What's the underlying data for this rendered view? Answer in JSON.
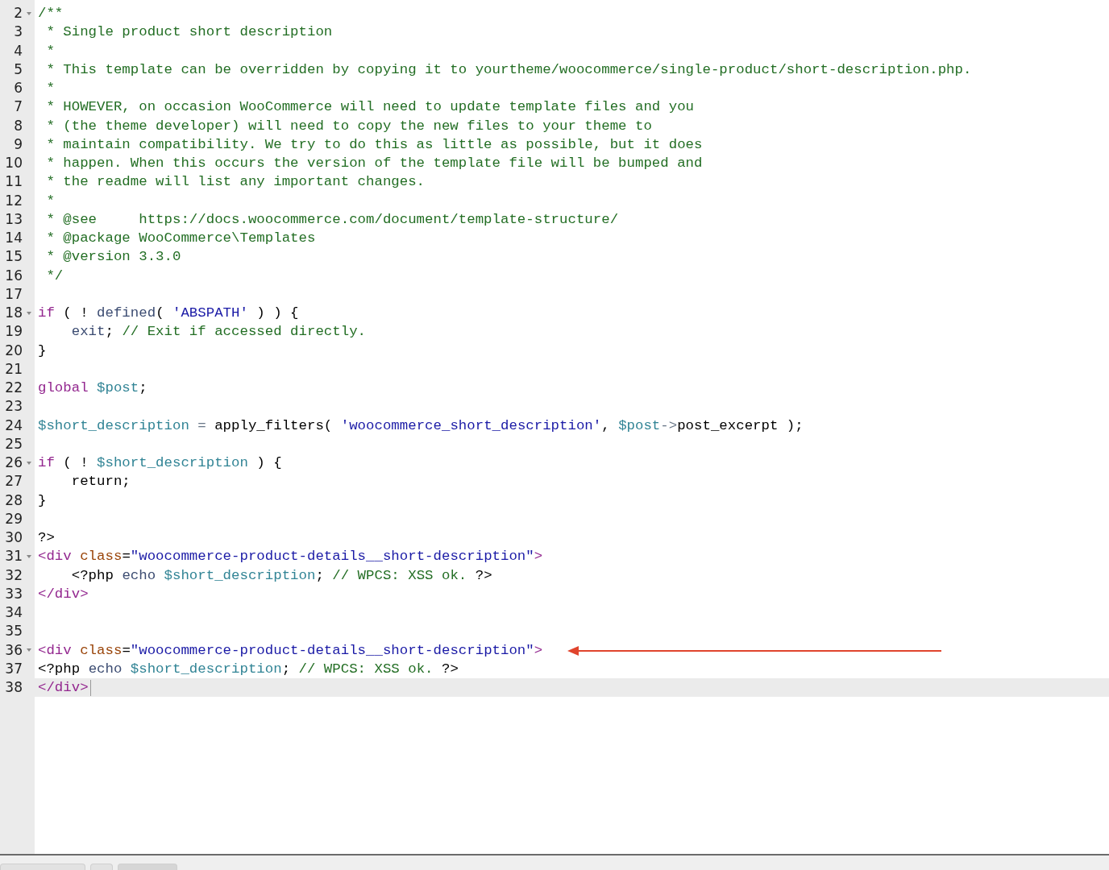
{
  "editor": {
    "lines": [
      {
        "number": "2",
        "fold": true,
        "active": false,
        "cursor": false,
        "marked": false,
        "tokens": [
          {
            "kind": "comment",
            "text": "/**"
          }
        ]
      },
      {
        "number": "3",
        "fold": false,
        "active": false,
        "cursor": false,
        "marked": false,
        "tokens": [
          {
            "kind": "comment",
            "text": " * Single product short description"
          }
        ]
      },
      {
        "number": "4",
        "fold": false,
        "active": false,
        "cursor": false,
        "marked": false,
        "tokens": [
          {
            "kind": "comment",
            "text": " *"
          }
        ]
      },
      {
        "number": "5",
        "fold": false,
        "active": false,
        "cursor": false,
        "marked": false,
        "tokens": [
          {
            "kind": "comment",
            "text": " * This template can be overridden by copying it to yourtheme/woocommerce/single-product/short-description.php."
          }
        ]
      },
      {
        "number": "6",
        "fold": false,
        "active": false,
        "cursor": false,
        "marked": false,
        "tokens": [
          {
            "kind": "comment",
            "text": " *"
          }
        ]
      },
      {
        "number": "7",
        "fold": false,
        "active": false,
        "cursor": false,
        "marked": false,
        "tokens": [
          {
            "kind": "comment",
            "text": " * HOWEVER, on occasion WooCommerce will need to update template files and you"
          }
        ]
      },
      {
        "number": "8",
        "fold": false,
        "active": false,
        "cursor": false,
        "marked": false,
        "tokens": [
          {
            "kind": "comment",
            "text": " * (the theme developer) will need to copy the new files to your theme to"
          }
        ]
      },
      {
        "number": "9",
        "fold": false,
        "active": false,
        "cursor": false,
        "marked": false,
        "tokens": [
          {
            "kind": "comment",
            "text": " * maintain compatibility. We try to do this as little as possible, but it does"
          }
        ]
      },
      {
        "number": "10",
        "fold": false,
        "active": false,
        "cursor": false,
        "marked": false,
        "tokens": [
          {
            "kind": "comment",
            "text": " * happen. When this occurs the version of the template file will be bumped and"
          }
        ]
      },
      {
        "number": "11",
        "fold": false,
        "active": false,
        "cursor": false,
        "marked": false,
        "tokens": [
          {
            "kind": "comment",
            "text": " * the readme will list any important changes."
          }
        ]
      },
      {
        "number": "12",
        "fold": false,
        "active": false,
        "cursor": false,
        "marked": false,
        "tokens": [
          {
            "kind": "comment",
            "text": " *"
          }
        ]
      },
      {
        "number": "13",
        "fold": false,
        "active": false,
        "cursor": false,
        "marked": false,
        "tokens": [
          {
            "kind": "comment",
            "text": " * @see     https://docs.woocommerce.com/document/template-structure/"
          }
        ]
      },
      {
        "number": "14",
        "fold": false,
        "active": false,
        "cursor": false,
        "marked": false,
        "tokens": [
          {
            "kind": "comment",
            "text": " * @package WooCommerce\\Templates"
          }
        ]
      },
      {
        "number": "15",
        "fold": false,
        "active": false,
        "cursor": false,
        "marked": false,
        "tokens": [
          {
            "kind": "comment",
            "text": " * @version 3.3.0"
          }
        ]
      },
      {
        "number": "16",
        "fold": false,
        "active": false,
        "cursor": false,
        "marked": false,
        "tokens": [
          {
            "kind": "comment",
            "text": " */"
          }
        ]
      },
      {
        "number": "17",
        "fold": false,
        "active": false,
        "cursor": false,
        "marked": false
      },
      {
        "number": "18",
        "fold": true,
        "active": false,
        "cursor": false,
        "marked": false,
        "tokens": [
          {
            "kind": "keyword",
            "text": "if"
          },
          {
            "kind": "plain",
            "text": " ( ! "
          },
          {
            "kind": "function",
            "text": "defined"
          },
          {
            "kind": "plain",
            "text": "( "
          },
          {
            "kind": "string",
            "text": "'ABSPATH'"
          },
          {
            "kind": "plain",
            "text": " ) ) {"
          }
        ]
      },
      {
        "number": "19",
        "fold": false,
        "active": false,
        "cursor": false,
        "marked": false,
        "tokens": [
          {
            "kind": "function",
            "text": "    exit"
          },
          {
            "kind": "plain",
            "text": "; "
          },
          {
            "kind": "comment",
            "text": "// Exit if accessed directly."
          }
        ]
      },
      {
        "number": "20",
        "fold": false,
        "active": false,
        "cursor": false,
        "marked": false,
        "tokens": [
          {
            "kind": "plain",
            "text": "}"
          }
        ]
      },
      {
        "number": "21",
        "fold": false,
        "active": false,
        "cursor": false,
        "marked": false
      },
      {
        "number": "22",
        "fold": false,
        "active": false,
        "cursor": false,
        "marked": false,
        "tokens": [
          {
            "kind": "keyword",
            "text": "global"
          },
          {
            "kind": "variable",
            "text": " $post"
          },
          {
            "kind": "plain",
            "text": ";"
          }
        ]
      },
      {
        "number": "23",
        "fold": false,
        "active": false,
        "cursor": false,
        "marked": false
      },
      {
        "number": "24",
        "fold": false,
        "active": false,
        "cursor": false,
        "marked": false,
        "tokens": [
          {
            "kind": "variable",
            "text": "$short_description"
          },
          {
            "kind": "operator",
            "text": " = "
          },
          {
            "kind": "plain",
            "text": "apply_filters( "
          },
          {
            "kind": "string",
            "text": "'woocommerce_short_description'"
          },
          {
            "kind": "plain",
            "text": ", "
          },
          {
            "kind": "variable",
            "text": "$post"
          },
          {
            "kind": "operator",
            "text": "->"
          },
          {
            "kind": "plain",
            "text": "post_excerpt );"
          }
        ]
      },
      {
        "number": "25",
        "fold": false,
        "active": false,
        "cursor": false,
        "marked": false
      },
      {
        "number": "26",
        "fold": true,
        "active": false,
        "cursor": false,
        "marked": false,
        "tokens": [
          {
            "kind": "keyword",
            "text": "if"
          },
          {
            "kind": "plain",
            "text": " ( ! "
          },
          {
            "kind": "variable",
            "text": "$short_description"
          },
          {
            "kind": "plain",
            "text": " ) {"
          }
        ]
      },
      {
        "number": "27",
        "fold": false,
        "active": false,
        "cursor": false,
        "marked": false,
        "tokens": [
          {
            "kind": "plain",
            "text": "    return;"
          }
        ]
      },
      {
        "number": "28",
        "fold": false,
        "active": false,
        "cursor": false,
        "marked": false,
        "tokens": [
          {
            "kind": "plain",
            "text": "}"
          }
        ]
      },
      {
        "number": "29",
        "fold": false,
        "active": false,
        "cursor": false,
        "marked": false
      },
      {
        "number": "30",
        "fold": false,
        "active": false,
        "cursor": false,
        "marked": false,
        "tokens": [
          {
            "kind": "plain",
            "text": "?>"
          }
        ]
      },
      {
        "number": "31",
        "fold": true,
        "active": false,
        "cursor": false,
        "marked": false,
        "tokens": [
          {
            "kind": "tag",
            "text": "<div"
          },
          {
            "kind": "attribute",
            "text": " class"
          },
          {
            "kind": "plain",
            "text": "="
          },
          {
            "kind": "string",
            "text": "\"woocommerce-product-details__short-description\""
          },
          {
            "kind": "tag",
            "text": ">"
          }
        ]
      },
      {
        "number": "32",
        "fold": false,
        "active": false,
        "cursor": false,
        "marked": false,
        "tokens": [
          {
            "kind": "plain",
            "text": "    <?php "
          },
          {
            "kind": "function",
            "text": "echo"
          },
          {
            "kind": "variable",
            "text": " $short_description"
          },
          {
            "kind": "plain",
            "text": "; "
          },
          {
            "kind": "comment",
            "text": "// WPCS: XSS ok."
          },
          {
            "kind": "plain",
            "text": " ?>"
          }
        ]
      },
      {
        "number": "33",
        "fold": false,
        "active": false,
        "cursor": false,
        "marked": false,
        "tokens": [
          {
            "kind": "tag",
            "text": "</div>"
          }
        ]
      },
      {
        "number": "34",
        "fold": false,
        "active": false,
        "cursor": false,
        "marked": false
      },
      {
        "number": "35",
        "fold": false,
        "active": false,
        "cursor": false,
        "marked": false
      },
      {
        "number": "36",
        "fold": true,
        "active": false,
        "cursor": false,
        "marked": true,
        "tokens": [
          {
            "kind": "tag",
            "text": "<div"
          },
          {
            "kind": "attribute",
            "text": " class"
          },
          {
            "kind": "plain",
            "text": "="
          },
          {
            "kind": "string",
            "text": "\"woocommerce-product-details__short-description\""
          },
          {
            "kind": "tag",
            "text": ">"
          }
        ]
      },
      {
        "number": "37",
        "fold": false,
        "active": false,
        "cursor": false,
        "marked": false,
        "tokens": [
          {
            "kind": "plain",
            "text": "<?php "
          },
          {
            "kind": "function",
            "text": "echo"
          },
          {
            "kind": "variable",
            "text": " $short_description"
          },
          {
            "kind": "plain",
            "text": "; "
          },
          {
            "kind": "comment",
            "text": "// WPCS: XSS ok."
          },
          {
            "kind": "plain",
            "text": " ?>"
          }
        ]
      },
      {
        "number": "38",
        "fold": false,
        "active": true,
        "cursor": true,
        "marked": false,
        "tokens": [
          {
            "kind": "tag",
            "text": "</div>"
          }
        ]
      }
    ]
  }
}
